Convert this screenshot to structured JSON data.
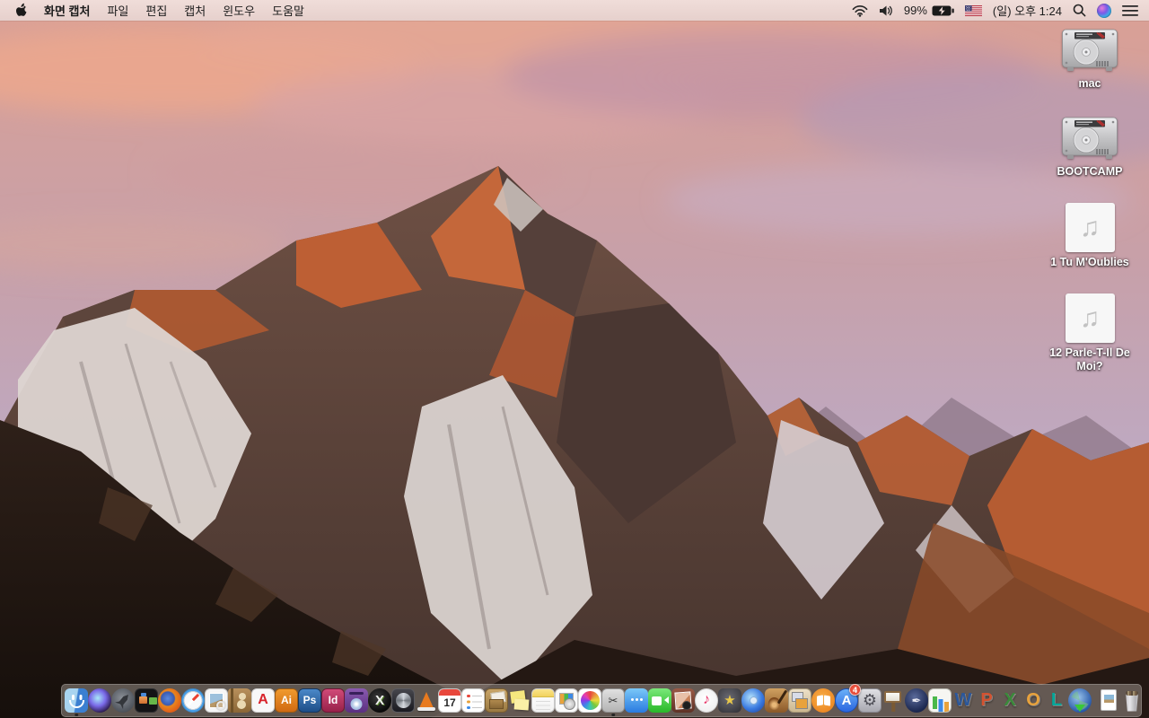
{
  "menu_bar": {
    "apple_logo": "apple-icon",
    "app_name": "화면 캡처",
    "menus": [
      "파일",
      "편집",
      "캡처",
      "윈도우",
      "도움말"
    ],
    "status": {
      "battery_percent": "99%",
      "clock": "(일) 오후 1:24",
      "icons": [
        "wifi-icon",
        "volume-icon",
        "battery-charging-icon",
        "us-flag-icon",
        "spotlight-search-icon",
        "siri-icon",
        "notification-center-icon"
      ]
    }
  },
  "desktop": {
    "wallpaper": "macos-sierra-mountain-sunset",
    "wallpaper_colors": {
      "sky_pink": "#d9a29a",
      "sky_lavender": "#c6b9cd",
      "rock_sunlit": "#c4673a",
      "rock_shadow": "#4a3732",
      "snow": "#ddd5d1",
      "foreground_dark": "#241a16"
    },
    "audio_glyph": "♫",
    "icons": [
      {
        "name": "mac-drive",
        "label": "mac",
        "type": "drive"
      },
      {
        "name": "bootcamp-drive",
        "label": "BOOTCAMP",
        "type": "drive"
      },
      {
        "name": "audio-file-1",
        "label": "1 Tu M'Oublies",
        "type": "audio"
      },
      {
        "name": "audio-file-2",
        "label": "12 Parle-T-Il De Moi?",
        "type": "audio"
      }
    ]
  },
  "dock": {
    "items": [
      {
        "name": "finder",
        "icon": "finder",
        "running": true
      },
      {
        "name": "siri",
        "icon": "siri"
      },
      {
        "name": "launchpad",
        "icon": "launchpad"
      },
      {
        "name": "mission-control",
        "icon": "mission-control"
      },
      {
        "name": "firefox",
        "icon": "firefox"
      },
      {
        "name": "safari",
        "icon": "safari"
      },
      {
        "name": "preview",
        "icon": "preview"
      },
      {
        "name": "contacts",
        "icon": "contacts"
      },
      {
        "name": "adobe-acrobat",
        "icon": "acrobat",
        "glyph": "A"
      },
      {
        "name": "adobe-illustrator",
        "icon": "illustrator",
        "glyph": "Ai"
      },
      {
        "name": "adobe-photoshop",
        "icon": "photoshop",
        "glyph": "Ps"
      },
      {
        "name": "adobe-indesign",
        "icon": "indesign",
        "glyph": "Id"
      },
      {
        "name": "toast-titanium",
        "icon": "toast"
      },
      {
        "name": "x-media-app",
        "icon": "x-app",
        "glyph": "X"
      },
      {
        "name": "disc-utility-app",
        "icon": "disc-tool"
      },
      {
        "name": "vlc",
        "icon": "vlc"
      },
      {
        "name": "calendar",
        "icon": "calendar",
        "glyph": "17"
      },
      {
        "name": "reminders",
        "icon": "reminders"
      },
      {
        "name": "archive-utility-app",
        "icon": "archive-box"
      },
      {
        "name": "stickies",
        "icon": "stickies"
      },
      {
        "name": "notes",
        "icon": "notes"
      },
      {
        "name": "installer-document-app",
        "icon": "installer-doc"
      },
      {
        "name": "photos",
        "icon": "photos"
      },
      {
        "name": "grab-screen-capture",
        "icon": "grab",
        "glyph": "✂",
        "running": true
      },
      {
        "name": "messages",
        "icon": "messages"
      },
      {
        "name": "facetime",
        "icon": "facetime"
      },
      {
        "name": "photo-booth",
        "icon": "photo-booth"
      },
      {
        "name": "itunes",
        "icon": "itunes",
        "glyph": "♪"
      },
      {
        "name": "imovie",
        "icon": "imovie",
        "glyph": "★"
      },
      {
        "name": "dvd-media-app",
        "icon": "dvd-app"
      },
      {
        "name": "garageband",
        "icon": "garageband"
      },
      {
        "name": "news-collage-app",
        "icon": "collage"
      },
      {
        "name": "ibooks",
        "icon": "ibooks"
      },
      {
        "name": "app-store",
        "icon": "app-store",
        "glyph": "A",
        "badge": "4"
      },
      {
        "name": "system-preferences",
        "icon": "sys-prefs",
        "glyph": "⚙"
      },
      {
        "name": "keynote",
        "icon": "keynote"
      },
      {
        "name": "pages",
        "icon": "pages",
        "glyph": "✒"
      },
      {
        "name": "numbers",
        "icon": "numbers"
      },
      {
        "name": "ms-word",
        "icon": "word",
        "glyph": "W"
      },
      {
        "name": "ms-powerpoint",
        "icon": "powerpoint",
        "glyph": "P"
      },
      {
        "name": "ms-excel",
        "icon": "excel",
        "glyph": "X"
      },
      {
        "name": "ms-outlook",
        "icon": "outlook",
        "glyph": "O"
      },
      {
        "name": "ms-lync",
        "icon": "lync",
        "glyph": "L"
      },
      {
        "name": "browser-download-app",
        "icon": "globe-download"
      },
      {
        "name": "dock-divider",
        "type": "divider"
      },
      {
        "name": "document-file",
        "icon": "doc-file"
      },
      {
        "name": "trash-full",
        "icon": "trash"
      }
    ]
  }
}
